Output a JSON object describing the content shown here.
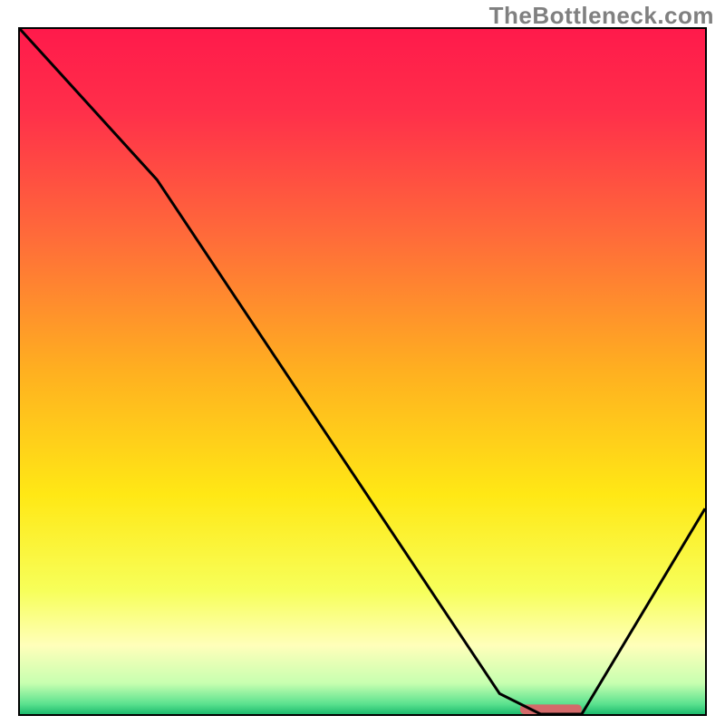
{
  "watermark": "TheBottleneck.com",
  "colors": {
    "frame_border": "#000000",
    "curve": "#000000",
    "marker": "#d46a6a",
    "gradient_stops": [
      {
        "offset": 0.0,
        "color": "#ff1a4b"
      },
      {
        "offset": 0.12,
        "color": "#ff2f4a"
      },
      {
        "offset": 0.3,
        "color": "#ff6a3a"
      },
      {
        "offset": 0.5,
        "color": "#ffb020"
      },
      {
        "offset": 0.68,
        "color": "#ffe815"
      },
      {
        "offset": 0.82,
        "color": "#f7ff5a"
      },
      {
        "offset": 0.9,
        "color": "#ffffba"
      },
      {
        "offset": 0.955,
        "color": "#c7ffb0"
      },
      {
        "offset": 0.985,
        "color": "#5ce28f"
      },
      {
        "offset": 1.0,
        "color": "#1dbb6d"
      }
    ]
  },
  "chart_data": {
    "type": "line",
    "title": "",
    "xlabel": "",
    "ylabel": "",
    "xlim": [
      0,
      100
    ],
    "ylim": [
      0,
      100
    ],
    "series": [
      {
        "name": "bottleneck-curve",
        "x": [
          0,
          20,
          70,
          76,
          82,
          100
        ],
        "values": [
          100,
          78,
          3,
          0,
          0,
          30
        ]
      }
    ],
    "marker": {
      "name": "optimal-range",
      "x_start": 73,
      "x_end": 82,
      "y": 0
    }
  }
}
